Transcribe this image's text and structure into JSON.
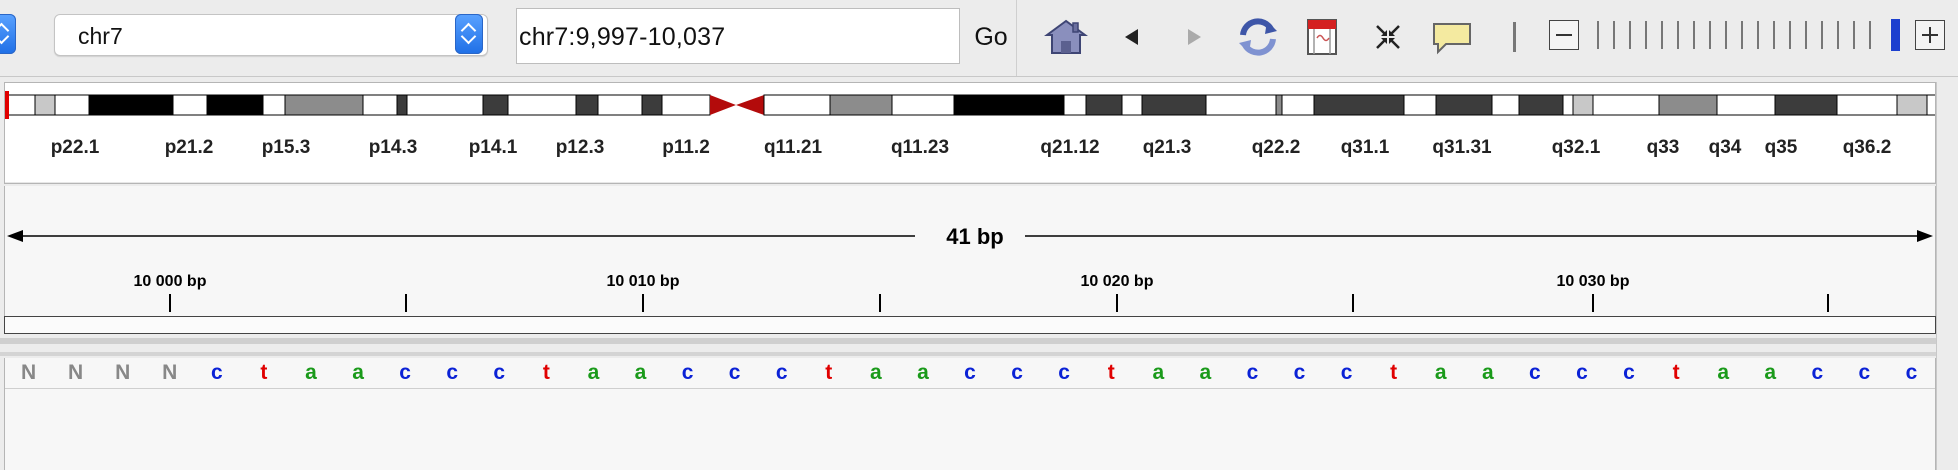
{
  "toolbar": {
    "chromosome": "chr7",
    "locus": "chr7:9,997-10,037",
    "go_label": "Go",
    "icons": [
      "home-icon",
      "back-icon",
      "forward-icon",
      "refresh-icon",
      "region-of-interest-icon",
      "fit-window-icon",
      "popup-info-icon"
    ],
    "zoom_ticks": 18
  },
  "colors": {
    "a": "#1a9a1a",
    "c": "#0b22d6",
    "g": "#d9a300",
    "t": "#e00000",
    "N": "#888888",
    "centromere": "#b30b0b",
    "zoom_current": "#1c3fcf"
  },
  "ideogram": {
    "bands": [
      {
        "s": "gneg"
      },
      {
        "s": "gpos25"
      },
      {
        "s": "gneg"
      },
      {
        "s": "gpos100"
      },
      {
        "s": "gneg"
      },
      {
        "s": "gpos100"
      },
      {
        "s": "gneg"
      },
      {
        "s": "gpos50"
      },
      {
        "s": "gneg"
      },
      {
        "s": "gpos75"
      },
      {
        "s": "gneg"
      },
      {
        "s": "gpos75"
      },
      {
        "s": "gneg"
      },
      {
        "s": "gpos75"
      },
      {
        "s": "gneg"
      },
      {
        "s": "gpos75"
      },
      {
        "s": "gneg"
      },
      {
        "s": "acen"
      },
      {
        "s": "acen"
      },
      {
        "s": "gneg"
      },
      {
        "s": "gpos50"
      },
      {
        "s": "gneg"
      },
      {
        "s": "gpos100"
      },
      {
        "s": "gneg"
      },
      {
        "s": "gpos75"
      },
      {
        "s": "gneg"
      },
      {
        "s": "gpos75"
      },
      {
        "s": "gneg"
      },
      {
        "s": "gpos50"
      },
      {
        "s": "gneg"
      },
      {
        "s": "gpos75"
      },
      {
        "s": "gneg"
      },
      {
        "s": "gpos75"
      },
      {
        "s": "gneg"
      },
      {
        "s": "gpos75"
      },
      {
        "s": "gneg"
      },
      {
        "s": "gpos25"
      },
      {
        "s": "gneg"
      },
      {
        "s": "gpos50"
      },
      {
        "s": "gneg"
      },
      {
        "s": "gpos75"
      },
      {
        "s": "gneg"
      },
      {
        "s": "gpos25"
      },
      {
        "s": "gneg"
      }
    ],
    "labels": [
      "p22.1",
      "p21.2",
      "p15.3",
      "p14.3",
      "p14.1",
      "p12.3",
      "p11.2",
      "q11.21",
      "q11.23",
      "q21.12",
      "q21.3",
      "q22.2",
      "q31.1",
      "q31.31",
      "q32.1",
      "q33",
      "q34",
      "q35",
      "q36.2"
    ]
  },
  "ruler": {
    "span": "41 bp",
    "ticks": [
      {
        "label": "10 000 bp"
      },
      {
        "label": ""
      },
      {
        "label": "10 010 bp"
      },
      {
        "label": ""
      },
      {
        "label": "10 020 bp"
      },
      {
        "label": ""
      },
      {
        "label": "10 030 bp"
      },
      {
        "label": ""
      }
    ]
  },
  "sequence": "NNNNctaaccctaaccctaaccctaaccctaaccctaaccc"
}
